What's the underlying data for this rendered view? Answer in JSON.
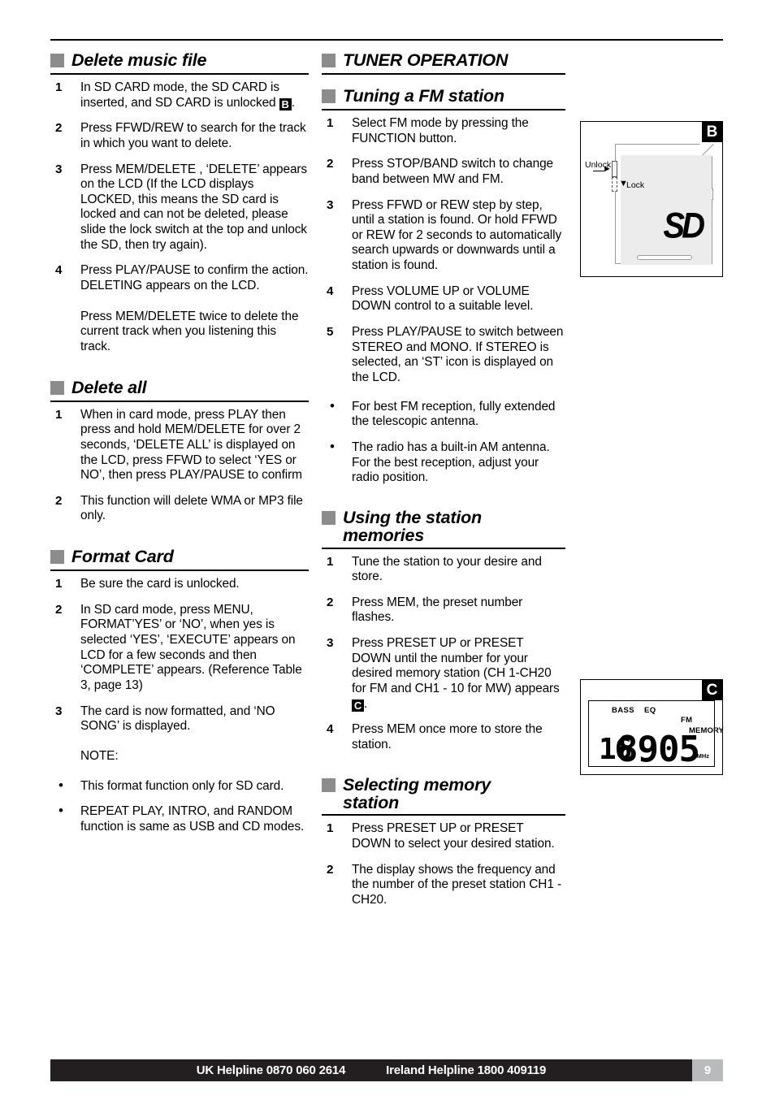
{
  "page": {
    "number": "9"
  },
  "footer": {
    "uk_label": "UK Helpline",
    "uk_number": "0870 060 2614",
    "ireland_label": "Ireland Helpline",
    "ireland_number": "1800 409119"
  },
  "left_column": {
    "sections": [
      {
        "heading": "Delete music file",
        "items": [
          {
            "marker": "1",
            "text_before": "In SD CARD mode, the SD CARD is inserted, and SD CARD is unlocked ",
            "badge": "B",
            "text_after": "."
          },
          {
            "marker": "2",
            "text": "Press FFWD/REW to search for the track in which you want to delete."
          },
          {
            "marker": "3",
            "text": "Press MEM/DELETE , ‘DELETE’ appears on the LCD (If the LCD displays LOCKED, this means the SD card is locked and can not be deleted, please slide the lock switch at the top and unlock the SD, then try again)."
          },
          {
            "marker": "4",
            "text": "Press PLAY/PAUSE to confirm the action. DELETING appears on the LCD."
          },
          {
            "marker": "",
            "text": "Press MEM/DELETE twice to delete the current track when you listening this track."
          }
        ]
      },
      {
        "heading": "Delete all",
        "items": [
          {
            "marker": "1",
            "text": "When in card mode, press PLAY then press and hold MEM/DELETE for over 2 seconds, ‘DELETE ALL’ is displayed on the LCD, press FFWD to select ‘YES or NO’, then press PLAY/PAUSE to confirm"
          },
          {
            "marker": "2",
            "text": "This function will delete WMA or MP3 file only."
          }
        ]
      },
      {
        "heading": "Format Card",
        "items": [
          {
            "marker": "1",
            "text": "Be sure the card is unlocked."
          },
          {
            "marker": "2",
            "text": "In SD card mode, press MENU, FORMAT’YES’ or ‘NO’, when yes is selected ‘YES’, ‘EXECUTE’ appears on LCD for a few seconds and then ‘COMPLETE’ appears. (Reference Table 3, page 13)"
          },
          {
            "marker": "3",
            "text": "The card is now formatted, and ‘NO SONG’ is displayed."
          },
          {
            "marker": "",
            "text": "NOTE:"
          },
          {
            "marker": "•",
            "text": "This format function only for SD card."
          },
          {
            "marker": "•",
            "text": "REPEAT PLAY, INTRO, and RANDOM function is same as USB and CD modes."
          }
        ]
      }
    ]
  },
  "right_column": {
    "sections": [
      {
        "heading": "TUNER OPERATION",
        "items": []
      },
      {
        "heading": "Tuning a FM station",
        "items": [
          {
            "marker": "1",
            "text": "Select FM mode by pressing the FUNCTION button."
          },
          {
            "marker": "2",
            "text": "Press STOP/BAND switch to change band between MW and FM."
          },
          {
            "marker": "3",
            "text": "Press FFWD or REW step by step, until a station is found. Or hold FFWD or REW for 2 seconds to automatically search upwards or downwards until a station is found."
          },
          {
            "marker": "4",
            "text": "Press VOLUME UP or VOLUME DOWN control to a suitable level."
          },
          {
            "marker": "5",
            "text": "Press PLAY/PAUSE to switch between STEREO and MONO. If STEREO is selected, an ‘ST’ icon is displayed on the LCD."
          },
          {
            "marker": "•",
            "text": "For best FM reception, fully extended the telescopic antenna."
          },
          {
            "marker": "•",
            "text": "The radio has a built-in AM antenna. For the best reception, adjust your radio position."
          }
        ]
      },
      {
        "heading": "Using the station memories",
        "items": [
          {
            "marker": "1",
            "text": "Tune the station to your desire and store."
          },
          {
            "marker": "2",
            "text": "Press MEM, the preset number flashes."
          },
          {
            "marker": "3",
            "text_before": "Press PRESET UP or PRESET DOWN until the number for your desired memory station (CH 1-CH20 for FM and CH1 - 10 for MW) appears ",
            "badge": "C",
            "text_after": "."
          },
          {
            "marker": "4",
            "text": "Press MEM once more to store the station."
          }
        ]
      },
      {
        "heading": "Selecting memory station",
        "items": [
          {
            "marker": "1",
            "text": "Press PRESET UP or PRESET DOWN to select your desired station."
          },
          {
            "marker": "2",
            "text": "The display shows the frequency and the number of the preset station CH1 - CH20."
          }
        ]
      }
    ]
  },
  "figure_b": {
    "letter": "B",
    "unlock_label": "Unlock",
    "lock_label": "Lock",
    "card_logo": "SD"
  },
  "figure_c": {
    "letter": "C",
    "bass": "BASS",
    "eq": "EQ",
    "band": "FM",
    "memory": "MEMORY",
    "channel": "16",
    "frequency": "8905",
    "unit": "MHz"
  }
}
